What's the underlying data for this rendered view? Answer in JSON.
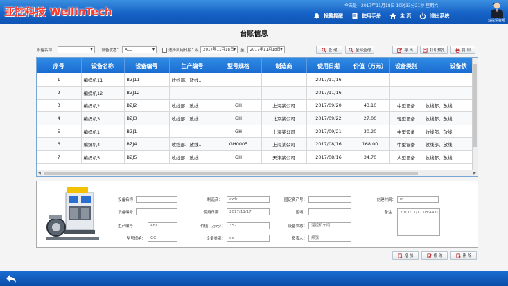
{
  "header": {
    "logo_text": "亚控科技 WellinTech",
    "datetime": "今天是：2017年11月18日 10时33分21秒 星期六",
    "nav": [
      {
        "label": "报警提醒",
        "icon": "bell-icon"
      },
      {
        "label": "使用手册",
        "icon": "book-icon"
      },
      {
        "label": "主 页",
        "icon": "home-icon"
      },
      {
        "label": "退出系统",
        "icon": "power-icon"
      }
    ],
    "user_label": "亚控设备组"
  },
  "page_title": "台账信息",
  "filters": {
    "device_name_label": "设备名称：",
    "device_name_value": "",
    "device_status_label": "设备状态：",
    "device_status_value": "ALL",
    "date_check_label": "选择启用日期：从",
    "date_from": "2017年11月18日",
    "date_to_label": "至",
    "date_to": "2017年11月18日"
  },
  "buttons": {
    "query": "查 询",
    "query_all": "全部查询",
    "export": "导 出",
    "print_preview": "打印预览",
    "print": "打 印",
    "add": "增 加",
    "modify": "修 改",
    "delete": "删 除"
  },
  "table": {
    "columns": [
      "序号",
      "设备名称",
      "设备编号",
      "生产编号",
      "型号规格",
      "制造商",
      "使用日期",
      "价值（万元）",
      "设备类别",
      "设备状"
    ],
    "rows": [
      [
        "1",
        "编织机11",
        "BZJ11",
        "收线部、放线...",
        "",
        "",
        "2017/11/16",
        "",
        "",
        ""
      ],
      [
        "2",
        "编织机12",
        "BZJ12",
        "",
        "",
        "",
        "2017/11/16",
        "",
        "",
        ""
      ],
      [
        "3",
        "编织机2",
        "BZJ2",
        "收线部、放线...",
        "GH",
        "上海某公司",
        "2017/09/20",
        "43.10",
        "中型设备",
        "收线部、放线"
      ],
      [
        "4",
        "编织机3",
        "BZJ3",
        "收线部、放线...",
        "GH",
        "北京某公司",
        "2017/09/22",
        "27.00",
        "轻型设备",
        "收线部、放线"
      ],
      [
        "5",
        "编织机1",
        "BZJ1",
        "",
        "GH",
        "上海某公司",
        "2017/09/21",
        "30.20",
        "中型设备",
        "收线部、放线"
      ],
      [
        "6",
        "编织机4",
        "BZJ4",
        "收线部、放线...",
        "GH0005",
        "上海某公司",
        "2017/08/16",
        "168.00",
        "中型设备",
        "收线部、放线"
      ],
      [
        "7",
        "编织机5",
        "BZJ5",
        "收线部、放线...",
        "GH",
        "天津某公司",
        "2017/08/16",
        "34.70",
        "大型设备",
        "收线部、放线"
      ]
    ]
  },
  "detail": {
    "device_name_label": "设备名称：",
    "device_name_value": "",
    "maker_label": "制造商：",
    "maker_value": "awh",
    "fixed_asset_label": "固定资产号：",
    "fixed_asset_value": "",
    "create_time_label": "创建时间：",
    "create_time_value": "rr",
    "device_no_label": "设备编号：",
    "device_no_value": "",
    "use_date_label": "使用日期：",
    "use_date_value": "2017/11/17",
    "area_label": "区域：",
    "area_value": "",
    "remark_label": "备注：",
    "remark_value": "2017/11/17 08:44:02",
    "prod_no_label": "生产编号：",
    "prod_no_value": "ABC",
    "price_label": "价值（万元）：",
    "price_value": "352",
    "status_label": "设备状态：",
    "status_value": "温控机车间",
    "model_label": "型号规格：",
    "model_value": "GG",
    "category_label": "设备类别：",
    "category_value": "de",
    "owner_label": "负责人：",
    "owner_value": "郑强"
  },
  "colors": {
    "header_blue": "#1763c7",
    "logo_red": "#ff3a2a",
    "table_header": "#2f8ae4"
  }
}
